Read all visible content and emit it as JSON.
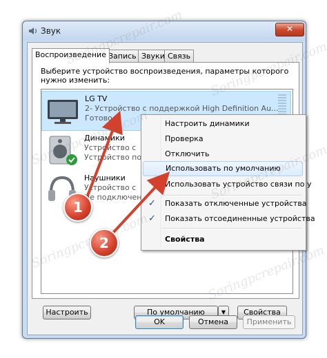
{
  "window": {
    "title": "Звук",
    "close_glyph": "✕"
  },
  "tabs": [
    "Воспроизведение",
    "Запись",
    "Звуки",
    "Связь"
  ],
  "instruction": "Выберите устройство воспроизведения, параметры которого нужно изменить:",
  "devices": [
    {
      "name": "LG TV",
      "desc": "2- Устройство с поддержкой High Definition Au...",
      "status": "Готово"
    },
    {
      "name": "Динамики",
      "desc": "Устройство с",
      "status": "Устройство по"
    },
    {
      "name": "Наушники",
      "desc": "Устройство с",
      "status": "Не подключено"
    }
  ],
  "buttons": {
    "configure": "Настроить",
    "default": "По умолчанию",
    "default_arrow": "▼",
    "properties": "Свойства",
    "ok": "OK",
    "cancel": "Отмена",
    "apply": "Применить"
  },
  "context_menu": {
    "items": [
      {
        "label": "Настроить динамики"
      },
      {
        "label": "Проверка"
      },
      {
        "label": "Отключить"
      },
      {
        "label": "Использовать по умолчанию"
      },
      {
        "label": "Использовать устройство связи по у"
      },
      {
        "label": "Показать отключенные устройства",
        "checked": true
      },
      {
        "label": "Показать отсоединенные устройства",
        "checked": true
      },
      {
        "label": "Свойства",
        "bold": true
      }
    ],
    "check_glyph": "✓"
  },
  "callouts": [
    "1",
    "2"
  ],
  "watermark": "Soringpcrepair.com",
  "colors": {
    "accent": "#cce8ff",
    "callout": "#d3402b",
    "check": "#1a4f9c"
  }
}
